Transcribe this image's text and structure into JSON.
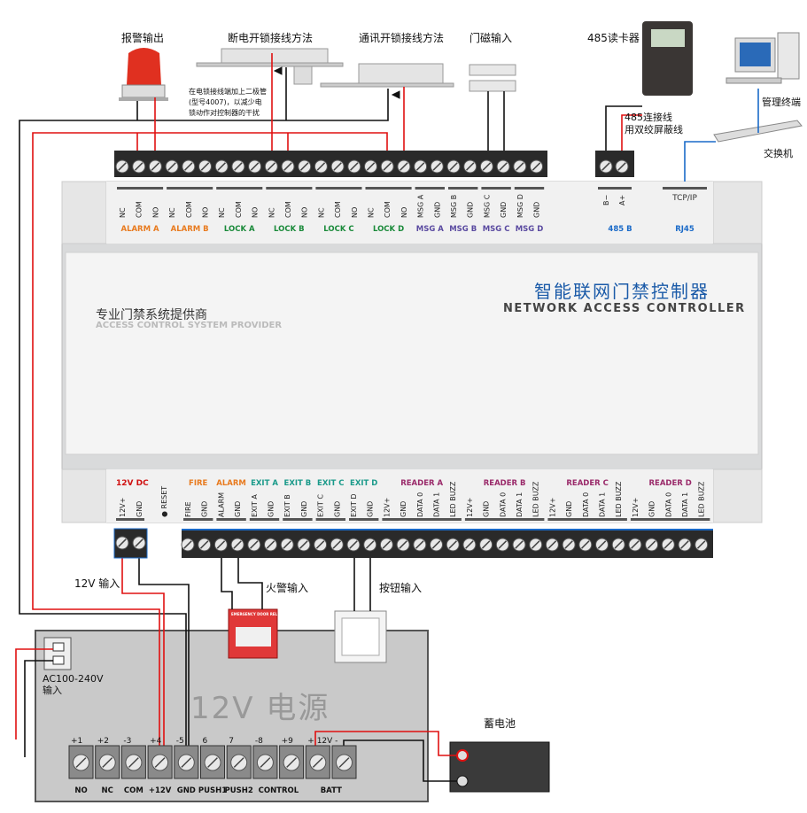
{
  "devices": {
    "alarm_output": "报警输出",
    "power_fail_lock": "断电开锁接线方法",
    "power_on_lock": "通讯开锁接线方法",
    "door_magnet": "门磁输入",
    "reader_485": "485读卡器",
    "mgmt_terminal": "管理终端",
    "switch": "交换机",
    "wire_note_485": [
      "485连接线",
      "用双绞屏蔽线"
    ],
    "diode_note": [
      "在电锁接线端加上二极管",
      "(型号4007)，以减少电",
      "锁动作对控制器的干扰"
    ],
    "input_12v": "12V 输入",
    "fire_input": "火警输入",
    "button_input": "按钮输入",
    "battery": "蓄电池",
    "emergency_label": "EMERGENCY DOOR RELEASE"
  },
  "controller": {
    "title_cn": "智能联网门禁控制器",
    "title_en": "NETWORK ACCESS CONTROLLER",
    "vendor_cn": "专业门禁系统提供商",
    "vendor_en": "ACCESS CONTROL SYSTEM PROVIDER",
    "top_terminals": [
      "NC",
      "COM",
      "NO",
      "NC",
      "COM",
      "NO",
      "NC",
      "COM",
      "NO",
      "NC",
      "COM",
      "NO",
      "NC",
      "COM",
      "NO",
      "NC",
      "COM",
      "NO",
      "MSG A",
      "GND",
      "MSG B",
      "GND",
      "MSG C",
      "GND",
      "MSG D",
      "GND"
    ],
    "top_groups": [
      {
        "label": "ALARM A",
        "color": "#e87a1e"
      },
      {
        "label": "ALARM B",
        "color": "#e87a1e"
      },
      {
        "label": "LOCK A",
        "color": "#1a8a3a"
      },
      {
        "label": "LOCK B",
        "color": "#1a8a3a"
      },
      {
        "label": "LOCK C",
        "color": "#1a8a3a"
      },
      {
        "label": "LOCK D",
        "color": "#1a8a3a"
      },
      {
        "label": "MSG A",
        "color": "#5a4aa0"
      },
      {
        "label": "MSG B",
        "color": "#5a4aa0"
      },
      {
        "label": "MSG C",
        "color": "#5a4aa0"
      },
      {
        "label": "MSG D",
        "color": "#5a4aa0"
      }
    ],
    "rs485_terminals": [
      "B−",
      "A+"
    ],
    "rs485_group": "485  B",
    "tcpip": "TCP/IP",
    "rj45": "RJ45",
    "dc_group": "12V DC",
    "dc_terminals": [
      "12V+",
      "GND"
    ],
    "reset": "RESET",
    "bottom_terminals": [
      "FIRE",
      "GND",
      "ALARM",
      "GND",
      "EXIT A",
      "GND",
      "EXIT B",
      "GND",
      "EXIT C",
      "GND",
      "EXIT D",
      "GND",
      "12V+",
      "GND",
      "DATA 0",
      "DATA 1",
      "LED BUZZ",
      "12V+",
      "GND",
      "DATA 0",
      "DATA 1",
      "LED BUZZ",
      "12V+",
      "GND",
      "DATA 0",
      "DATA 1",
      "LED BUZZ",
      "12V+",
      "GND",
      "DATA 0",
      "DATA 1",
      "LED BUZZ"
    ],
    "bottom_groups": [
      {
        "label": "FIRE",
        "color": "#e87a1e"
      },
      {
        "label": "ALARM",
        "color": "#e87a1e"
      },
      {
        "label": "EXIT A",
        "color": "#1a9a8a"
      },
      {
        "label": "EXIT B",
        "color": "#1a9a8a"
      },
      {
        "label": "EXIT C",
        "color": "#1a9a8a"
      },
      {
        "label": "EXIT D",
        "color": "#1a9a8a"
      },
      {
        "label": "READER A",
        "color": "#9a2a6a"
      },
      {
        "label": "READER B",
        "color": "#9a2a6a"
      },
      {
        "label": "READER C",
        "color": "#9a2a6a"
      },
      {
        "label": "READER D",
        "color": "#9a2a6a"
      }
    ]
  },
  "power_supply": {
    "title": "12V 电源",
    "ac_label": [
      "AC100-240V",
      "输入"
    ],
    "numbers": [
      "+1",
      "+2",
      "-3",
      "+4",
      "-5",
      "6",
      "7",
      "-8",
      "+9",
      "+ 12V -",
      ""
    ],
    "names": [
      "NO",
      "NC",
      "COM",
      "+12V",
      "GND",
      "PUSH1",
      "PUSH2",
      "CONTROL",
      "",
      "BATT",
      ""
    ]
  },
  "colors": {
    "wire_red": "#e01010",
    "wire_black": "#111111",
    "network_blue": "#1a6ac8",
    "title_blue": "#1a5aa8"
  }
}
